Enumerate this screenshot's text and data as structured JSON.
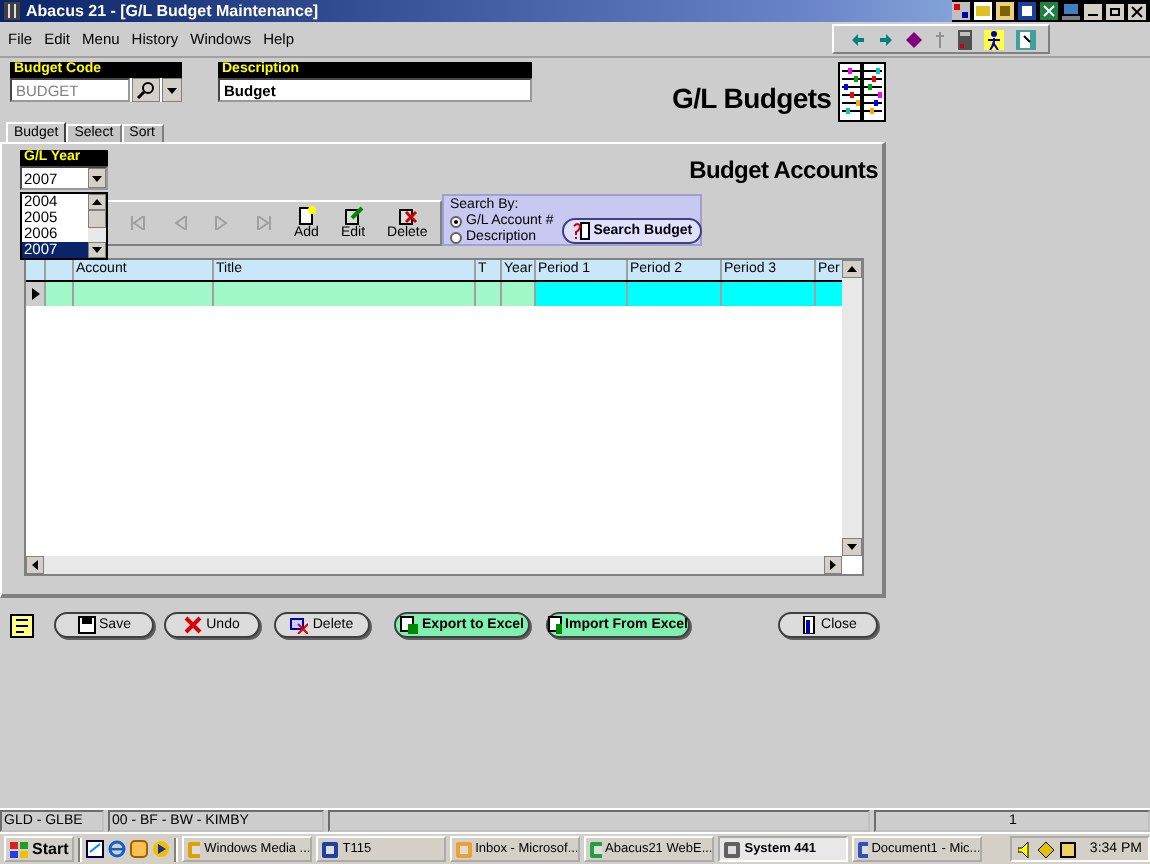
{
  "window": {
    "title": "Abacus 21 - [G/L Budget Maintenance]"
  },
  "menu": [
    "File",
    "Edit",
    "Menu",
    "History",
    "Windows",
    "Help"
  ],
  "budget_code": {
    "label": "Budget Code",
    "value": "BUDGET",
    "disabled": true
  },
  "description": {
    "label": "Description",
    "value": "Budget"
  },
  "heading": "G/L Budgets",
  "tabs": [
    {
      "label": "Budget",
      "selected": true
    },
    {
      "label": "Select",
      "selected": false
    },
    {
      "label": "Sort",
      "selected": false
    }
  ],
  "section_title": "Budget Accounts",
  "gl_year": {
    "label": "G/L Year",
    "value": "2007",
    "options": [
      {
        "label": "2004",
        "selected": false
      },
      {
        "label": "2005",
        "selected": false
      },
      {
        "label": "2006",
        "selected": false
      },
      {
        "label": "2007",
        "selected": true
      }
    ]
  },
  "record_buttons": [
    {
      "label": "Add",
      "kind": "add"
    },
    {
      "label": "Edit",
      "kind": "edit"
    },
    {
      "label": "Delete",
      "kind": "delete"
    }
  ],
  "search": {
    "title": "Search By:",
    "options": [
      {
        "label": "G/L Account #",
        "selected": true
      },
      {
        "label": "Description",
        "selected": false
      }
    ],
    "button": "Search Budget"
  },
  "table": {
    "columns": [
      {
        "kind": "key"
      },
      {
        "label": "Account",
        "kind": "key"
      },
      {
        "label": "Title",
        "kind": "key"
      },
      {
        "label": "T",
        "kind": "key"
      },
      {
        "label": "Year",
        "kind": "key"
      },
      {
        "label": "Period 1",
        "kind": "amount"
      },
      {
        "label": "Period 2",
        "kind": "amount"
      },
      {
        "label": "Period 3",
        "kind": "amount"
      },
      {
        "label": "Per",
        "kind": "amount"
      }
    ],
    "rows": [
      {
        "current": true
      }
    ]
  },
  "buttons": [
    {
      "label": "Save",
      "kind": "save"
    },
    {
      "label": "Undo",
      "kind": "undo"
    },
    {
      "label": "Delete",
      "kind": "delete"
    },
    {
      "label": "Export to Excel",
      "kind": "export"
    },
    {
      "label": "Import From Excel",
      "kind": "import"
    },
    {
      "label": "Close",
      "kind": "close"
    }
  ],
  "status_bar": {
    "module": "GLD - GLBE",
    "user": "00 - BF - BW - KIMBY",
    "page": "1"
  },
  "taskbar": {
    "start": "Start",
    "tasks": [
      {
        "label": "Windows Media ...",
        "kind": "media",
        "selected": false
      },
      {
        "label": "T115",
        "kind": "app",
        "selected": false
      },
      {
        "label": "Inbox - Microsof...",
        "kind": "mail",
        "selected": false
      },
      {
        "label": "Abacus21 WebE...",
        "kind": "web",
        "selected": false
      },
      {
        "label": "System 441",
        "kind": "abacus",
        "selected": true
      },
      {
        "label": "Document1 - Mic...",
        "kind": "doc",
        "selected": false
      }
    ],
    "clock": "3:34 PM"
  }
}
